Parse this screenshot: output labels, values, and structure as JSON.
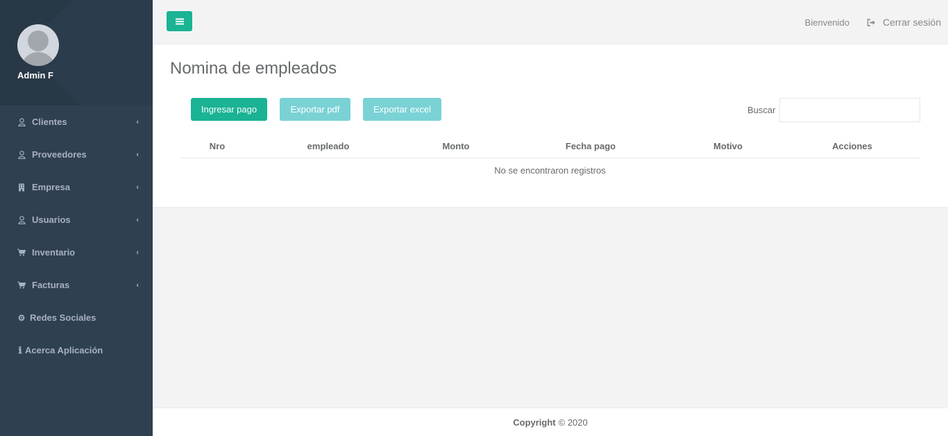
{
  "sidebar": {
    "user_name": "Admin F",
    "items": [
      {
        "label": "Clientes",
        "icon": "user-icon",
        "has_submenu": true
      },
      {
        "label": "Proveedores",
        "icon": "user-icon",
        "has_submenu": true
      },
      {
        "label": "Empresa",
        "icon": "building-icon",
        "has_submenu": true
      },
      {
        "label": "Usuarios",
        "icon": "user-icon",
        "has_submenu": true
      },
      {
        "label": "Inventario",
        "icon": "cart-icon",
        "has_submenu": true
      },
      {
        "label": "Facturas",
        "icon": "cart-icon",
        "has_submenu": true
      },
      {
        "label": "Redes Sociales",
        "icon": "gear-icon",
        "has_submenu": false
      },
      {
        "label": "Acerca Aplicación",
        "icon": "info-icon",
        "has_submenu": false
      }
    ]
  },
  "topbar": {
    "welcome": "Bienvenido",
    "logout": "Cerrar sesión"
  },
  "main": {
    "title": "Nomina de empleados",
    "buttons": {
      "add": "Ingresar pago",
      "pdf": "Exportar pdf",
      "excel": "Exportar excel"
    },
    "search": {
      "label": "Buscar",
      "value": "",
      "placeholder": ""
    },
    "table": {
      "columns": [
        "Nro",
        "empleado",
        "Monto",
        "Fecha pago",
        "Motivo",
        "Acciones"
      ],
      "empty_message": "No se encontraron registros"
    }
  },
  "footer": {
    "bold": "Copyright",
    "text": "© 2020"
  },
  "colors": {
    "sidebar": "#2f4050",
    "accent": "#1ab394",
    "muted_button": "#7ad2d5"
  }
}
